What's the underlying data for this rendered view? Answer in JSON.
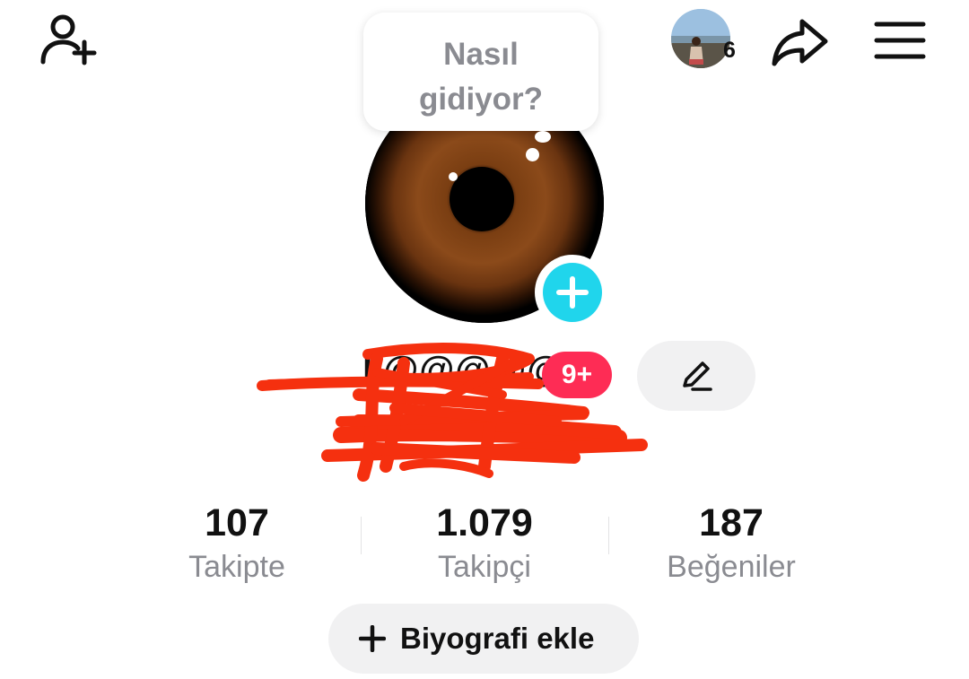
{
  "header": {
    "add_friend_icon": "person-add-icon",
    "viewers": {
      "count": "6",
      "avatar": "profile-viewer-avatar"
    },
    "share_icon": "share-arrow-icon",
    "menu_icon": "hamburger-menu-icon"
  },
  "profile": {
    "avatar": "brown-eye-photo",
    "note_bubble": "Nasıl\ngidiyor?",
    "add_photo_icon": "plus-icon",
    "username": "k@@@@@0",
    "notification_badge": "9+",
    "edit_icon": "pencil-icon"
  },
  "stats": [
    {
      "value": "107",
      "label": "Takipte"
    },
    {
      "value": "1.079",
      "label": "Takipçi"
    },
    {
      "value": "187",
      "label": "Beğeniler"
    }
  ],
  "bio_button": {
    "icon": "plus-icon",
    "label": "Biyografi ekle"
  },
  "colors": {
    "accent_cyan": "#20d5ec",
    "badge_red": "#fe2c55",
    "scribble_red": "#f5300f",
    "muted_text": "#8a8b91",
    "button_bg": "#f1f1f2"
  }
}
